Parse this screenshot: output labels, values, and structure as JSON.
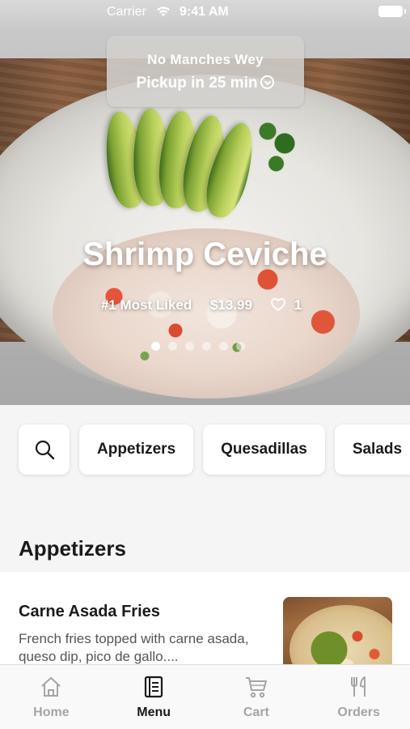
{
  "status_bar": {
    "carrier": "Carrier",
    "time": "9:41 AM"
  },
  "pickup": {
    "restaurant": "No Manches Wey",
    "time_label": "Pickup in 25 min"
  },
  "featured": {
    "title": "Shrimp Ceviche",
    "badge": "#1 Most Liked",
    "price": "$13.99",
    "likes": "1",
    "slides": 6,
    "active_slide": 1
  },
  "categories": {
    "search_icon": "search-icon",
    "items": [
      "Appetizers",
      "Quesadillas",
      "Salads"
    ]
  },
  "section": {
    "title": "Appetizers"
  },
  "menu_items": [
    {
      "name": "Carne Asada Fries",
      "description": "French fries topped with carne asada, queso dip, pico de gallo...."
    }
  ],
  "tabs": [
    {
      "label": "Home",
      "icon": "home-icon",
      "active": false
    },
    {
      "label": "Menu",
      "icon": "menu-book-icon",
      "active": true
    },
    {
      "label": "Cart",
      "icon": "cart-icon",
      "active": false
    },
    {
      "label": "Orders",
      "icon": "utensils-icon",
      "active": false
    }
  ],
  "colors": {
    "active_tab": "#1a1a1a",
    "inactive_tab": "#a5a5a5",
    "card_bg": "#ffffff",
    "page_bg": "#f5f5f5"
  }
}
